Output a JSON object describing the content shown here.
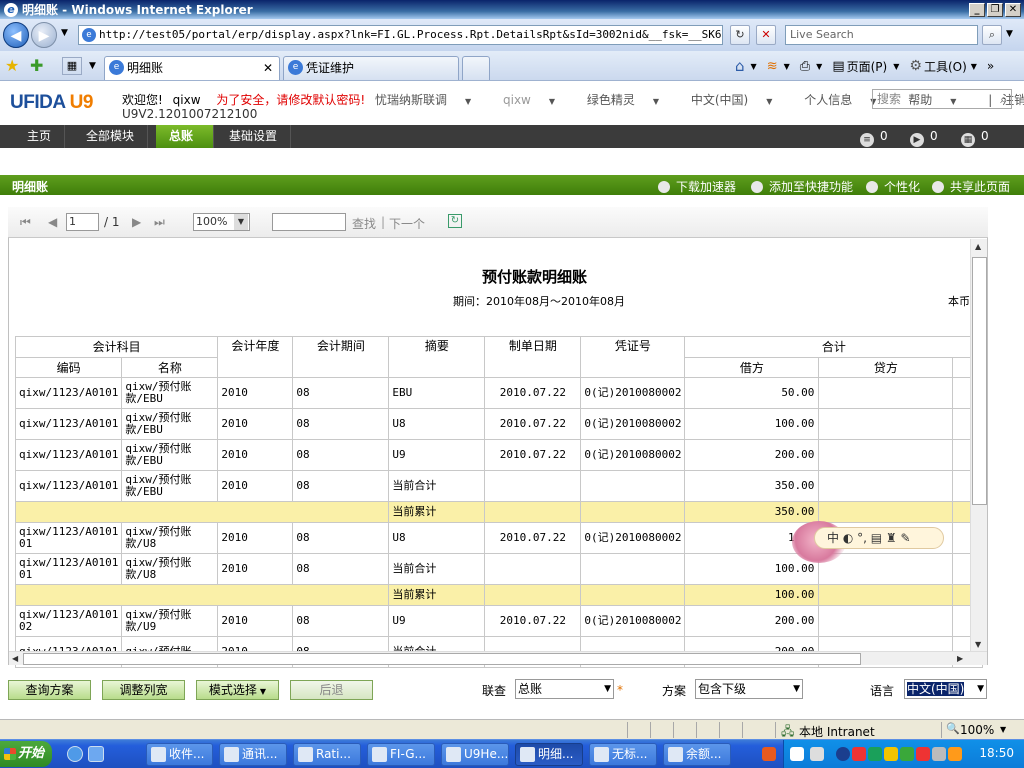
{
  "window": {
    "title": "明细账 - Windows Internet Explorer"
  },
  "browser": {
    "address": "http://test05/portal/erp/display.aspx?lnk=FI.GL.Process.Rpt.DetailsRpt&sId=3002nid&__fsk=__SK648",
    "badge": "360",
    "live_search_placeholder": "Live Search",
    "tabs": [
      {
        "label": "明细账"
      },
      {
        "label": "凭证维护"
      }
    ],
    "tools": {
      "page": "页面(P)",
      "tools": "工具(O)"
    }
  },
  "app": {
    "logo_main": "UFIDA",
    "logo_u9": "U9",
    "welcome": "欢迎您!",
    "user": "qixw",
    "warning": "为了安全，请修改默认密码!",
    "company": "忧瑞纳斯联调",
    "version": "U9V2.1201007212100",
    "topnav": [
      {
        "label": "忧瑞纳斯联调"
      },
      {
        "label": "qixw"
      },
      {
        "label": "绿色精灵"
      },
      {
        "label": "中文(中国)"
      },
      {
        "label": "个人信息"
      },
      {
        "label": "帮助"
      }
    ],
    "logout": "注销",
    "search_placeholder": "搜索"
  },
  "menu": {
    "items": [
      {
        "label": "主页"
      },
      {
        "label": "全部模块"
      },
      {
        "label": "总账"
      },
      {
        "label": "基础设置"
      }
    ],
    "counts": [
      {
        "value": "0"
      },
      {
        "value": "0"
      },
      {
        "value": "0"
      }
    ]
  },
  "pagebar": {
    "title": "明细账",
    "actions": [
      {
        "label": "下载加速器"
      },
      {
        "label": "添加至快捷功能"
      },
      {
        "label": "个性化"
      },
      {
        "label": "共享此页面"
      }
    ]
  },
  "report_toolbar": {
    "page_current": "1",
    "page_total": "/ 1",
    "zoom": "100%",
    "find": "查找",
    "next": "下一个"
  },
  "report": {
    "title": "预付账款明细账",
    "period": "期间：2010年08月～2010年08月",
    "right_text": "本币",
    "headers": {
      "account": "会计科目",
      "year": "会计年度",
      "period": "会计期间",
      "summary": "摘要",
      "date": "制单日期",
      "voucher": "凭证号",
      "total": "合计",
      "code": "编码",
      "name": "名称",
      "debit": "借方",
      "credit": "贷方"
    },
    "rows": [
      {
        "code": "qixw/1123/A0101",
        "name": "qixw/预付账款/EBU",
        "year": "2010",
        "period": "08",
        "summary": "EBU",
        "date": "2010.07.22",
        "voucher": "0(记)2010080002",
        "debit": "50.00",
        "credit": ""
      },
      {
        "code": "qixw/1123/A0101",
        "name": "qixw/预付账款/EBU",
        "year": "2010",
        "period": "08",
        "summary": "U8",
        "date": "2010.07.22",
        "voucher": "0(记)2010080002",
        "debit": "100.00",
        "credit": ""
      },
      {
        "code": "qixw/1123/A0101",
        "name": "qixw/预付账款/EBU",
        "year": "2010",
        "period": "08",
        "summary": "U9",
        "date": "2010.07.22",
        "voucher": "0(记)2010080002",
        "debit": "200.00",
        "credit": ""
      },
      {
        "code": "qixw/1123/A0101",
        "name": "qixw/预付账款/EBU",
        "year": "2010",
        "period": "08",
        "summary": "当前合计",
        "date": "",
        "voucher": "",
        "debit": "350.00",
        "credit": ""
      },
      {
        "cumulative": true,
        "summary": "当前累计",
        "debit": "350.00"
      },
      {
        "code": "qixw/1123/A0101 01",
        "name": "qixw/预付账款/U8",
        "year": "2010",
        "period": "08",
        "summary": "U8",
        "date": "2010.07.22",
        "voucher": "0(记)2010080002",
        "debit": "100.",
        "credit": ""
      },
      {
        "code": "qixw/1123/A0101 01",
        "name": "qixw/预付账款/U8",
        "year": "2010",
        "period": "08",
        "summary": "当前合计",
        "date": "",
        "voucher": "",
        "debit": "100.00",
        "credit": ""
      },
      {
        "cumulative": true,
        "summary": "当前累计",
        "debit": "100.00"
      },
      {
        "code": "qixw/1123/A0101 02",
        "name": "qixw/预付账款/U9",
        "year": "2010",
        "period": "08",
        "summary": "U9",
        "date": "2010.07.22",
        "voucher": "0(记)2010080002",
        "debit": "200.00",
        "credit": ""
      },
      {
        "code": "qixw/1123/A0101",
        "name": "qixw/预付账",
        "year": "2010",
        "period": "08",
        "summary": "当前合计",
        "date": "",
        "voucher": "",
        "debit": "200.00",
        "credit": ""
      }
    ]
  },
  "ime": {
    "text": "中 ◐ °, ▤ ♜ ✎"
  },
  "actions": {
    "query": "查询方案",
    "adjust": "调整列宽",
    "mode": "模式选择",
    "back": "后退",
    "link_label": "联查",
    "link_value": "总账",
    "scheme_label": "方案",
    "scheme_value": "包含下级",
    "lang_label": "语言",
    "lang_value": "中文(中国)"
  },
  "statusbar": {
    "zone": "本地 Intranet",
    "zoom": "100%"
  },
  "taskbar": {
    "start": "开始",
    "tasks": [
      {
        "label": "收件..."
      },
      {
        "label": "通讯..."
      },
      {
        "label": "Rati..."
      },
      {
        "label": "FI-G..."
      },
      {
        "label": "U9He..."
      },
      {
        "label": "明细..."
      },
      {
        "label": "无标..."
      },
      {
        "label": "余额..."
      }
    ],
    "clock": "18:50"
  },
  "colors": {
    "brand_green": "#4d8f10",
    "menu_dark": "#3b3b3b",
    "cumulative_row": "#faf0a8",
    "warning": "#e00000"
  }
}
